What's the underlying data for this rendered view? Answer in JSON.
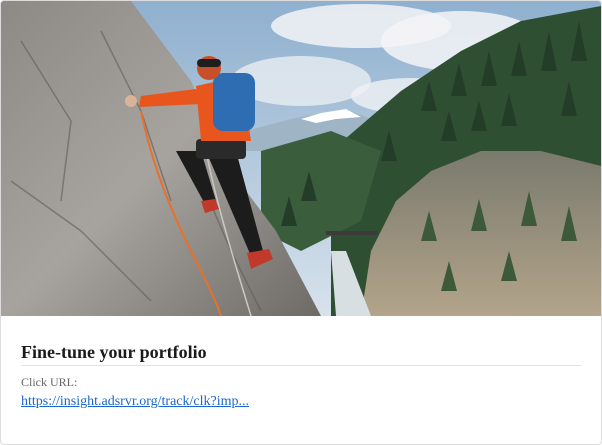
{
  "card": {
    "image_alt": "Rock climber in orange jacket scaling a granite cliff above a forested canyon with snowy mountains",
    "title": "Fine-tune your portfolio",
    "click_url_label": "Click URL:",
    "click_url_text": "https://insight.adsrvr.org/track/clk?imp..."
  },
  "colors": {
    "link": "#1a66cc",
    "title": "#1a1a1a",
    "label": "#666666",
    "jacket": "#e8561e",
    "backpack": "#2f6db3"
  }
}
